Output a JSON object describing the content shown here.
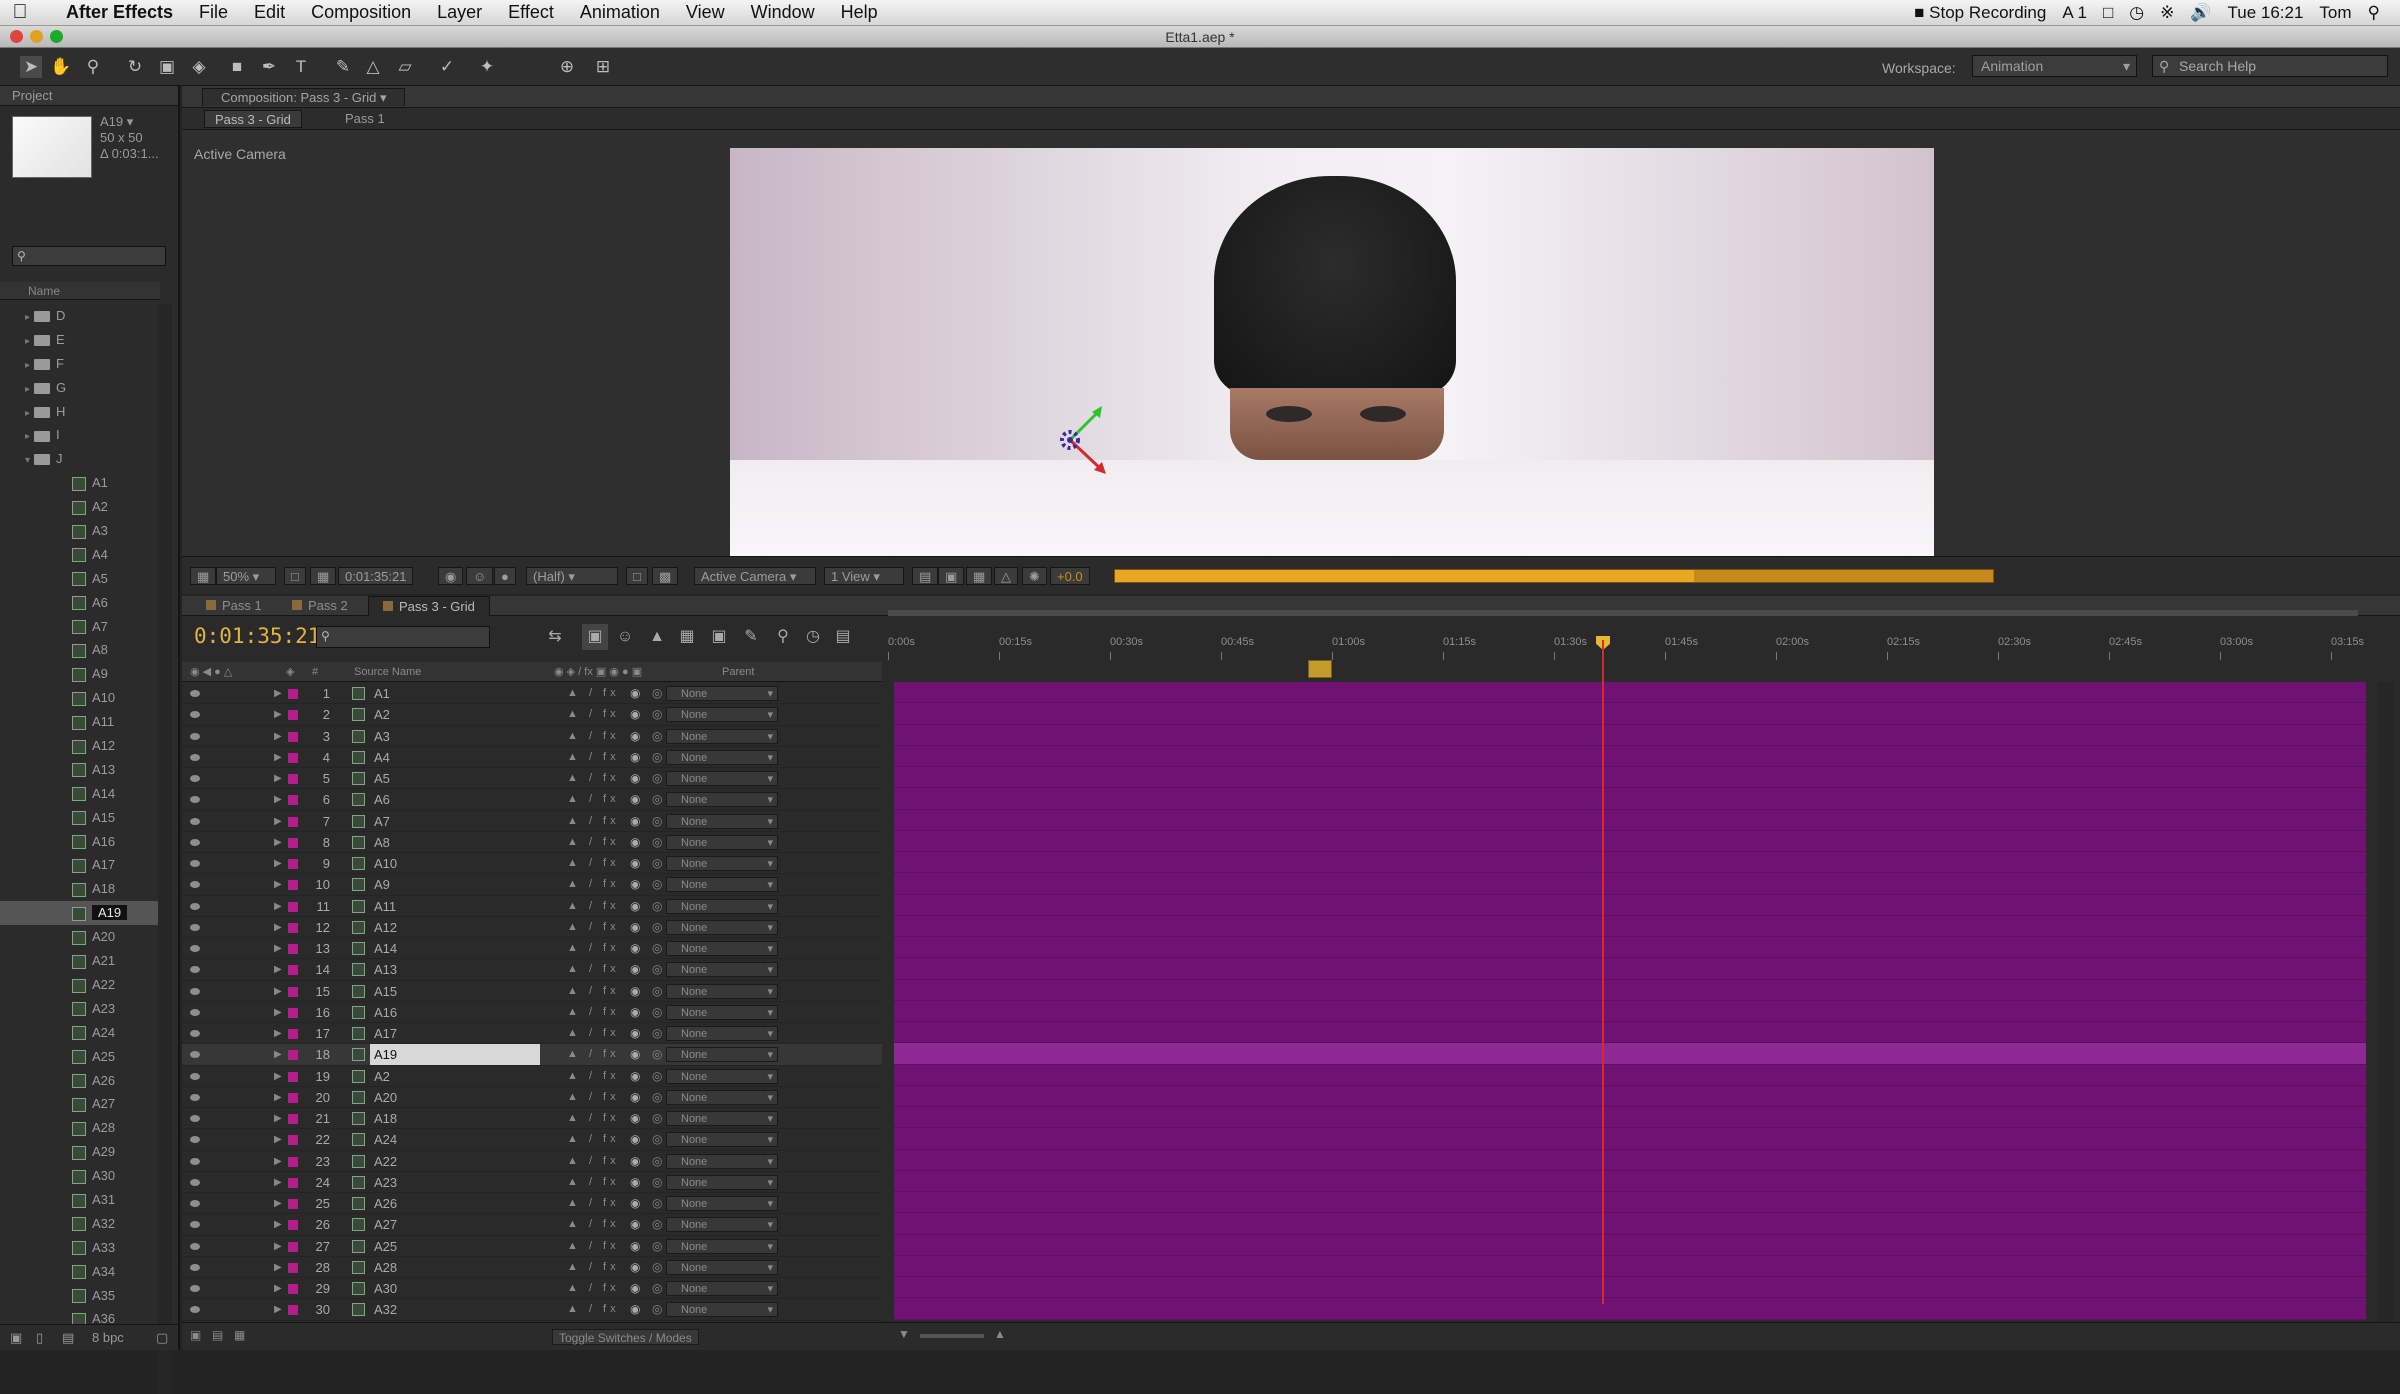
{
  "menubar": {
    "app_name": "After Effects",
    "items": [
      "File",
      "Edit",
      "Composition",
      "Layer",
      "Effect",
      "Animation",
      "View",
      "Window",
      "Help"
    ],
    "right": {
      "stop_recording": "Stop Recording",
      "ai_badge": "A 1",
      "clock": "Tue 16:21",
      "user": "Tom"
    }
  },
  "window": {
    "title": "Etta1.aep *"
  },
  "toolbar": {
    "workspace_label": "Workspace:",
    "workspace_value": "Animation",
    "search_placeholder": "Search Help"
  },
  "project": {
    "tab": "Project",
    "selected_name": "A19 ▾",
    "info_size": "50 x 50",
    "info_duration": "Δ 0:03:1...",
    "name_header": "Name",
    "folders": [
      "D",
      "E",
      "F",
      "G",
      "H",
      "I",
      "J"
    ],
    "items": [
      "A1",
      "A2",
      "A3",
      "A4",
      "A5",
      "A6",
      "A7",
      "A8",
      "A9",
      "A10",
      "A11",
      "A12",
      "A13",
      "A14",
      "A15",
      "A16",
      "A17",
      "A18",
      "A19",
      "A20",
      "A21",
      "A22",
      "A23",
      "A24",
      "A25",
      "A26",
      "A27",
      "A28",
      "A29",
      "A30",
      "A31",
      "A32",
      "A33",
      "A34",
      "A35",
      "A36"
    ],
    "selected_item": "A19",
    "bit_depth": "8 bpc"
  },
  "composition": {
    "tab": "Composition: Pass 3 - Grid",
    "crumbs": [
      "Pass 3 - Grid",
      "Pass 1"
    ],
    "active_camera_label": "Active Camera",
    "viewer_bar": {
      "zoom": "50%",
      "timecode": "0:01:35:21",
      "resolution": "(Half)",
      "camera": "Active Camera",
      "views": "1 View",
      "exposure": "+0.0"
    },
    "render_progress": 0.66
  },
  "timeline": {
    "tabs": [
      "Pass 1",
      "Pass 2",
      "Pass 3 - Grid"
    ],
    "active_tab": "Pass 3 - Grid",
    "timecode": "0:01:35:21",
    "columns": {
      "source_name": "Source Name",
      "parent": "Parent"
    },
    "ruler": [
      "0:00s",
      "00:15s",
      "00:30s",
      "00:45s",
      "01:00s",
      "01:15s",
      "01:30s",
      "01:45s",
      "02:00s",
      "02:15s",
      "02:30s",
      "02:45s",
      "03:00s",
      "03:15s"
    ],
    "layers": [
      {
        "num": "1",
        "name": "A1",
        "parent": "None"
      },
      {
        "num": "2",
        "name": "A2",
        "parent": "None"
      },
      {
        "num": "3",
        "name": "A3",
        "parent": "None"
      },
      {
        "num": "4",
        "name": "A4",
        "parent": "None"
      },
      {
        "num": "5",
        "name": "A5",
        "parent": "None"
      },
      {
        "num": "6",
        "name": "A6",
        "parent": "None"
      },
      {
        "num": "7",
        "name": "A7",
        "parent": "None"
      },
      {
        "num": "8",
        "name": "A8",
        "parent": "None"
      },
      {
        "num": "9",
        "name": "A10",
        "parent": "None"
      },
      {
        "num": "10",
        "name": "A9",
        "parent": "None"
      },
      {
        "num": "11",
        "name": "A11",
        "parent": "None"
      },
      {
        "num": "12",
        "name": "A12",
        "parent": "None"
      },
      {
        "num": "13",
        "name": "A14",
        "parent": "None"
      },
      {
        "num": "14",
        "name": "A13",
        "parent": "None"
      },
      {
        "num": "15",
        "name": "A15",
        "parent": "None"
      },
      {
        "num": "16",
        "name": "A16",
        "parent": "None"
      },
      {
        "num": "17",
        "name": "A17",
        "parent": "None"
      },
      {
        "num": "18",
        "name": "A19",
        "parent": "None"
      },
      {
        "num": "19",
        "name": "A2",
        "parent": "None"
      },
      {
        "num": "20",
        "name": "A20",
        "parent": "None"
      },
      {
        "num": "21",
        "name": "A18",
        "parent": "None"
      },
      {
        "num": "22",
        "name": "A24",
        "parent": "None"
      },
      {
        "num": "23",
        "name": "A22",
        "parent": "None"
      },
      {
        "num": "24",
        "name": "A23",
        "parent": "None"
      },
      {
        "num": "25",
        "name": "A26",
        "parent": "None"
      },
      {
        "num": "26",
        "name": "A27",
        "parent": "None"
      },
      {
        "num": "27",
        "name": "A25",
        "parent": "None"
      },
      {
        "num": "28",
        "name": "A28",
        "parent": "None"
      },
      {
        "num": "29",
        "name": "A30",
        "parent": "None"
      },
      {
        "num": "30",
        "name": "A32",
        "parent": "None"
      }
    ],
    "selected_layer": "18",
    "toggle_label": "Toggle Switches / Modes",
    "colors": {
      "layer_bar": "#6f1273",
      "selected_bar": "#8d2894",
      "label": "#b21f8c",
      "timecode": "#e2b43f"
    }
  }
}
